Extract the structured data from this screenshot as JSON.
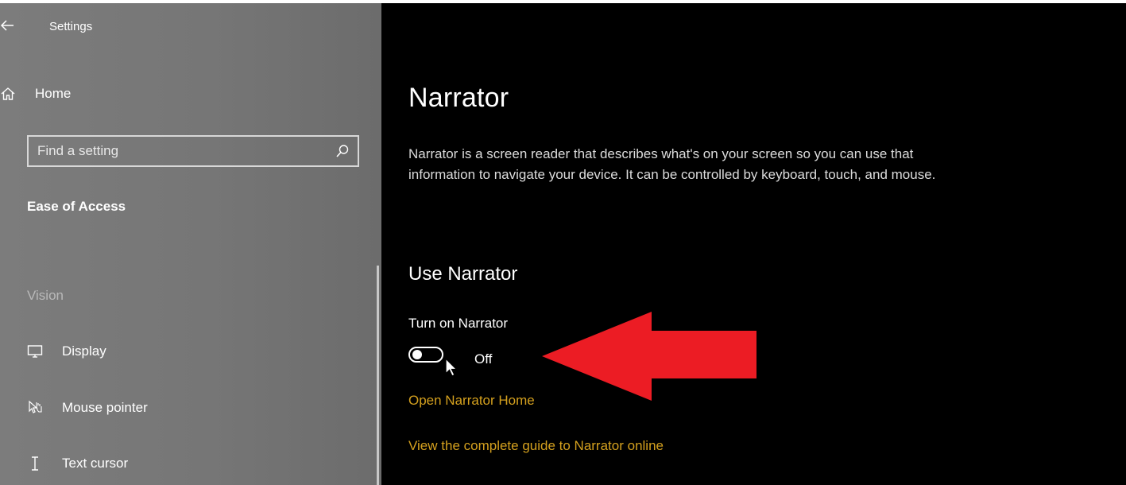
{
  "window": {
    "title": "Settings"
  },
  "sidebar": {
    "home_label": "Home",
    "search": {
      "placeholder": "Find a setting"
    },
    "section_title": "Ease of Access",
    "group_label": "Vision",
    "items": [
      {
        "label": "Display",
        "icon": "monitor-icon"
      },
      {
        "label": "Mouse pointer",
        "icon": "mouse-pointer-icon"
      },
      {
        "label": "Text cursor",
        "icon": "text-cursor-icon"
      }
    ]
  },
  "main": {
    "title": "Narrator",
    "description": "Narrator is a screen reader that describes what's on your screen so you can use that information to navigate your device. It can be controlled by keyboard, touch, and mouse.",
    "subheading": "Use Narrator",
    "toggle": {
      "label": "Turn on Narrator",
      "state": "Off"
    },
    "links": [
      "Open Narrator Home",
      "View the complete guide to Narrator online"
    ]
  },
  "colors": {
    "sidebar_bg": "#767676",
    "main_bg": "#000000",
    "link": "#d4a01e",
    "annotation_arrow": "#ec1c24"
  }
}
